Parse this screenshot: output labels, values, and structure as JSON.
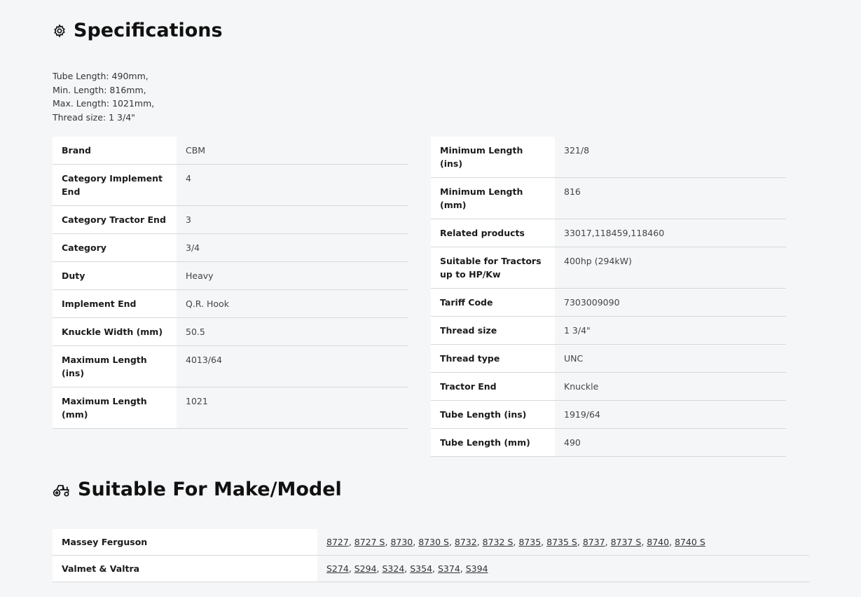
{
  "specifications": {
    "title": "Specifications",
    "icon": "gear-icon",
    "summary": [
      "Tube Length: 490mm,",
      "Min. Length: 816mm,",
      "Max. Length: 1021mm,",
      "Thread size: 1 3/4\""
    ],
    "left_table": [
      {
        "key": "Brand",
        "value": "CBM"
      },
      {
        "key": "Category Implement End",
        "value": "4"
      },
      {
        "key": "Category Tractor End",
        "value": "3"
      },
      {
        "key": "Category",
        "value": "3/4"
      },
      {
        "key": "Duty",
        "value": "Heavy"
      },
      {
        "key": "Implement End",
        "value": "Q.R. Hook"
      },
      {
        "key": "Knuckle Width (mm)",
        "value": "50.5"
      },
      {
        "key": "Maximum Length (ins)",
        "value": "4013/64"
      },
      {
        "key": "Maximum Length (mm)",
        "value": "1021"
      }
    ],
    "right_table": [
      {
        "key": "Minimum Length (ins)",
        "value": "321/8"
      },
      {
        "key": "Minimum Length (mm)",
        "value": "816"
      },
      {
        "key": "Related products",
        "value": "33017,118459,118460"
      },
      {
        "key": "Suitable for Tractors up to HP/Kw",
        "value": "400hp (294kW)"
      },
      {
        "key": "Tariff Code",
        "value": "7303009090"
      },
      {
        "key": "Thread size",
        "value": "1 3/4\""
      },
      {
        "key": "Thread type",
        "value": "UNC"
      },
      {
        "key": "Tractor End",
        "value": "Knuckle"
      },
      {
        "key": "Tube Length (ins)",
        "value": "1919/64"
      },
      {
        "key": "Tube Length (mm)",
        "value": "490"
      }
    ]
  },
  "suitable": {
    "title": "Suitable For Make/Model",
    "icon": "tractor-icon",
    "makes": [
      {
        "make": "Massey Ferguson",
        "models": [
          "8727",
          "8727 S",
          "8730",
          "8730 S",
          "8732",
          "8732 S",
          "8735",
          "8735 S",
          "8737",
          "8737 S",
          "8740",
          "8740 S"
        ]
      },
      {
        "make": "Valmet & Valtra",
        "models": [
          "S274",
          "S294",
          "S324",
          "S354",
          "S374",
          "S394"
        ]
      }
    ]
  }
}
